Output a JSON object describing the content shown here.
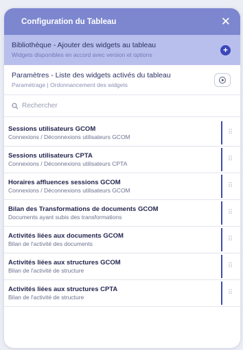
{
  "header": {
    "title": "Configuration du Tableau"
  },
  "library": {
    "title": "Bibliothèque - Ajouter des widgets au tableau",
    "subtitle": "Widgets disponibles en accord avec version et options"
  },
  "parameters": {
    "title": "Paramètres - Liste des widgets activés du tableau",
    "subtitle": "Paramétrage | Ordonnancement des widgets"
  },
  "search": {
    "placeholder": "Rechercher"
  },
  "widgets": [
    {
      "name": "Sessions utilisateurs GCOM",
      "description": "Connexions / Déconnexions utilisateurs GCOM"
    },
    {
      "name": "Sessions utilisateurs CPTA",
      "description": "Connexions / Déconnexions utilisateurs CPTA"
    },
    {
      "name": "Horaires affluences sessions GCOM",
      "description": "Connexions / Déconnexions utilisateurs GCOM"
    },
    {
      "name": "Bilan des Transformations de documents GCOM",
      "description": "Documents ayant subis des transformations"
    },
    {
      "name": "Activités liées aux documents GCOM",
      "description": "Bilan de l'activité des documents"
    },
    {
      "name": "Activités liées aux structures GCOM",
      "description": "Bilan de l'activité de structure"
    },
    {
      "name": "Activités liées aux structures CPTA",
      "description": "Bilan de l'activité de structure"
    }
  ],
  "icons": {
    "close": "close-icon",
    "add": "plus-circle-icon",
    "play": "play-circle-icon",
    "search": "search-icon",
    "drag": "drag-handle-icon"
  },
  "colors": {
    "header_bg": "#7d87cf",
    "library_bg": "#b9bfec",
    "accent": "#3a46b9"
  }
}
